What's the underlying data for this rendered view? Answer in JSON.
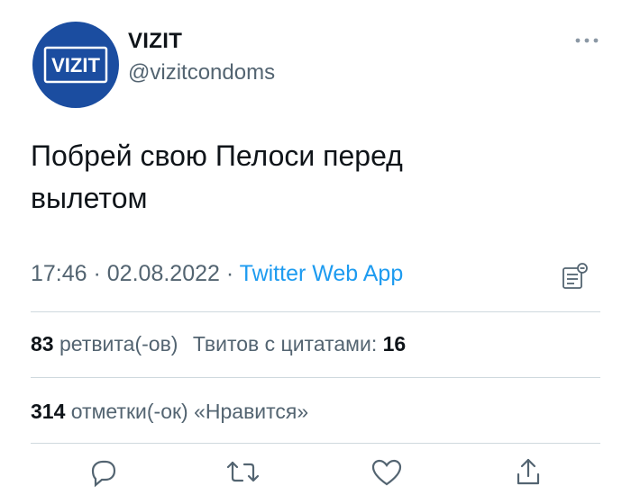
{
  "author": {
    "avatar_text": "VIZIT",
    "name": "VIZIT",
    "handle": "@vizitcondoms"
  },
  "tweet": {
    "text_line1": "Побрей свою Пелоси перед",
    "text_line2": "вылетом",
    "time": "17:46",
    "separator": " · ",
    "date": "02.08.2022",
    "source": "Twitter Web App"
  },
  "stats": {
    "retweets_count": "83",
    "retweets_label": " ретвита(-ов)",
    "quotes_label": "Твитов с цитатами: ",
    "quotes_count": "16",
    "likes_count": "314",
    "likes_label": " отметки(-ок) «Нравится»"
  },
  "icons": {
    "more": "more-icon",
    "analytics": "analytics-icon",
    "reply": "reply-icon",
    "retweet": "retweet-icon",
    "like": "like-icon",
    "share": "share-icon"
  },
  "colors": {
    "avatar_bg": "#1b4da0",
    "link": "#1d9bf0",
    "secondary_text": "#536471",
    "divider": "#cfd9de"
  }
}
